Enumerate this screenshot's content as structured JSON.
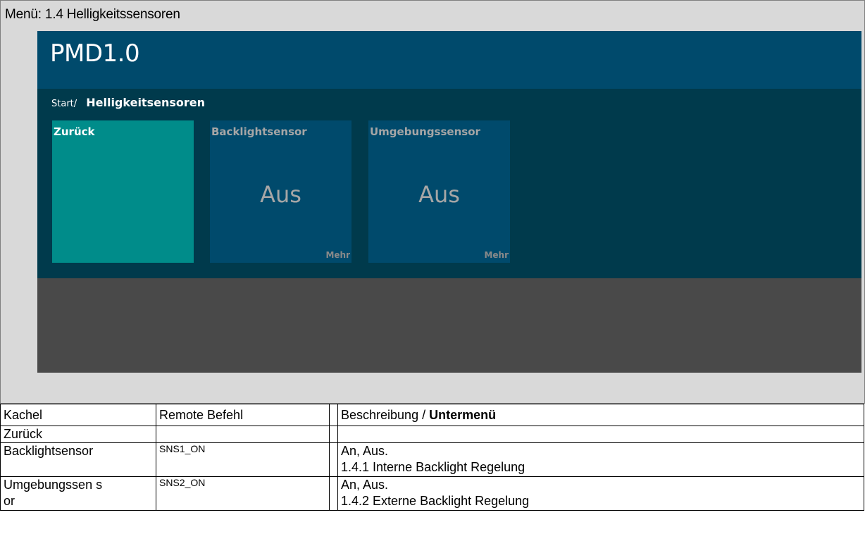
{
  "menu_header": {
    "label": "Menü: 1.4 Helligkeitssensoren"
  },
  "app": {
    "title": "PMD1.0",
    "breadcrumb": {
      "start": "Start/",
      "current": "Helligkeitsensoren"
    },
    "tiles": [
      {
        "title": "Zurück",
        "value": "",
        "more": ""
      },
      {
        "title": "Backlightsensor",
        "value": "Aus",
        "more": "Mehr"
      },
      {
        "title": "Umgebungssensor",
        "value": "Aus",
        "more": "Mehr"
      }
    ],
    "colors": {
      "header": "#004a6c",
      "body": "#003a4c",
      "tile_back": "#008c8a",
      "tile": "#004a6c",
      "footer": "#494949"
    }
  },
  "table": {
    "headers": {
      "kachel": "Kachel",
      "remote": "Remote Befehl",
      "desc_prefix": "Beschreibung / ",
      "desc_highlight": "Untermenü"
    },
    "rows": [
      {
        "kachel": "Zurück",
        "remote": "",
        "desc1": "",
        "desc2": ""
      },
      {
        "kachel": "Backlightsensor",
        "remote": "SNS1_ON",
        "desc1": "An, Aus.",
        "desc2": "1.4.1 Interne Backlight Regelung"
      },
      {
        "kachel": "Umgebungssen sor",
        "remote": "SNS2_ON",
        "desc1": "An, Aus.",
        "desc2": "1.4.2 Externe Backlight Regelung"
      }
    ]
  }
}
